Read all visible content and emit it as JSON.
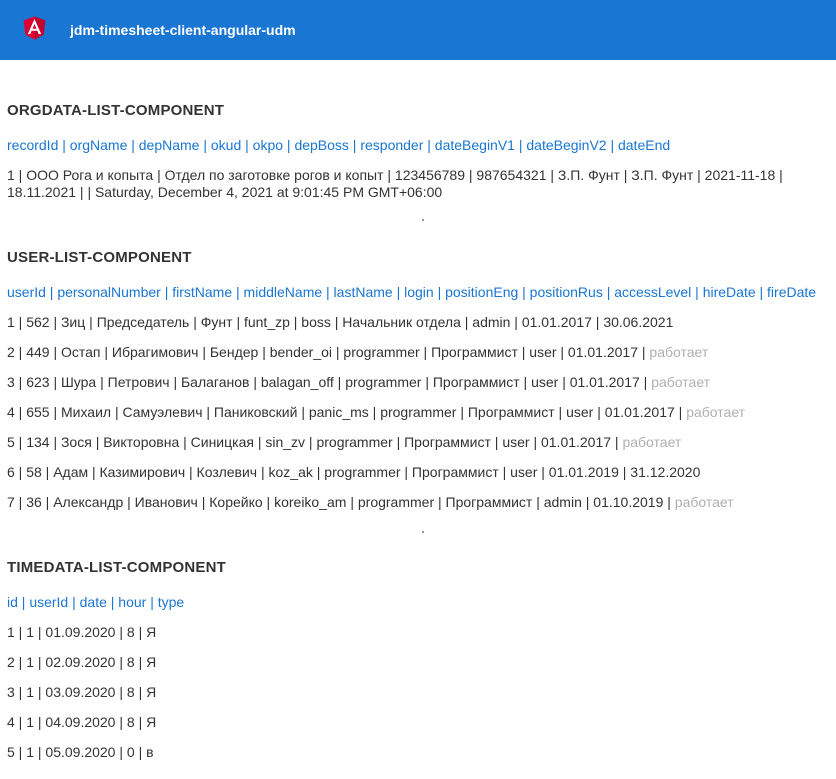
{
  "app": {
    "title": "jdm-timesheet-client-angular-udm"
  },
  "orgdata": {
    "heading": "ORGDATA-LIST-COMPONENT",
    "columns": "recordId | orgName | depName | okud | okpo | depBoss | responder | dateBeginV1 | dateBeginV2 | dateEnd",
    "rows": [
      "1 | ООО Рога и копыта | Отдел по заготовке рогов и копыт | 123456789 | 987654321 | З.П. Фунт | З.П. Фунт | 2021-11-18 | 18.11.2021 | | Saturday, December 4, 2021 at 9:01:45 PM GMT+06:00"
    ]
  },
  "users": {
    "heading": "USER-LIST-COMPONENT",
    "columns": "userId | personalNumber | firstName | middleName | lastName | login | positionEng | positionRus | accessLevel | hireDate | fireDate",
    "rows": [
      {
        "text": "1 | 562 | Зиц | Председатель | Фунт | funt_zp | boss | Начальник отдела | admin | 01.01.2017 | 30.06.2021",
        "status": ""
      },
      {
        "text": "2 | 449 | Остап | Ибрагимович | Бендер | bender_oi | programmer | Программист | user | 01.01.2017 | ",
        "status": "работает"
      },
      {
        "text": "3 | 623 | Шура | Петрович | Балаганов | balagan_off | programmer | Программист | user | 01.01.2017 | ",
        "status": "работает"
      },
      {
        "text": "4 | 655 | Михаил | Самуэлевич | Паниковский | panic_ms | programmer | Программист | user | 01.01.2017 | ",
        "status": "работает"
      },
      {
        "text": "5 | 134 | Зося | Викторовна | Синицкая | sin_zv | programmer | Программист | user | 01.01.2017 | ",
        "status": "работает"
      },
      {
        "text": "6 | 58 | Адам | Казимирович | Козлевич | koz_ak | programmer | Программист | user | 01.01.2019 | 31.12.2020",
        "status": ""
      },
      {
        "text": "7 | 36 | Александр | Иванович | Корейко | koreiko_am | programmer | Программист | admin | 01.10.2019 | ",
        "status": "работает"
      }
    ]
  },
  "timedata": {
    "heading": "TIMEDATA-LIST-COMPONENT",
    "columns": "id | userId | date | hour | type",
    "rows": [
      "1 | 1 | 01.09.2020 | 8 | Я",
      "2 | 1 | 02.09.2020 | 8 | Я",
      "3 | 1 | 03.09.2020 | 8 | Я",
      "4 | 1 | 04.09.2020 | 8 | Я",
      "5 | 1 | 05.09.2020 | 0 | в"
    ]
  },
  "colors": {
    "toolbar": "#1976d2",
    "link": "#1976d2",
    "muted": "#b0b0b0"
  }
}
